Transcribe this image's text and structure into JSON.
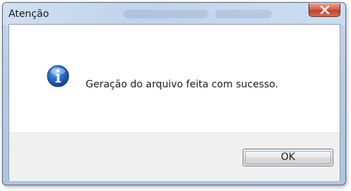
{
  "dialog": {
    "title": "Atenção",
    "message": "Geração do arquivo feita com sucesso.",
    "ok_label": "OK",
    "icon": "info-icon",
    "close_icon": "close-icon"
  },
  "colors": {
    "close_button": "#c2402a",
    "info_icon": "#1f5fbf",
    "button_area": "#f0f0f0",
    "window_frame": "#b7cbe4"
  }
}
